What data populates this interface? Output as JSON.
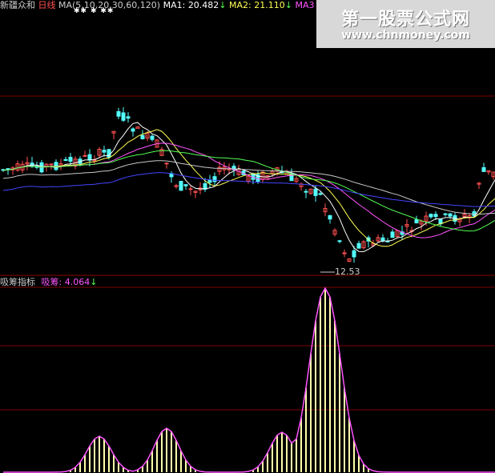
{
  "header": {
    "stock_name": "新疆众和",
    "period": "日线",
    "ma_label": "MA(5,10,20,30,60,120)",
    "ma1_label": "MA1:",
    "ma1_value": "20.482",
    "ma1_arrow": "↓",
    "ma2_label": "MA2:",
    "ma2_value": "21.110",
    "ma2_arrow": "↓",
    "ma3_label": "MA3",
    "marks": "✱✱  ✱    ✱✱"
  },
  "watermark": {
    "title": "第一股票公式网",
    "url": "www.chnmoney.com"
  },
  "low_price_label": "12.53",
  "indicator": {
    "panel_name": "吸筹指标",
    "line_label": "吸筹:",
    "line_value": "4.064",
    "line_arrow": "↓"
  },
  "colors": {
    "background": "#000000",
    "up_candle": "#ff5050",
    "down_candle": "#54ffff",
    "ma1": "#ffffff",
    "ma2": "#ffff54",
    "ma3": "#ff54ff",
    "ma4": "#54ff54",
    "ma5": "#c8c8c8",
    "ma6": "#4444ff",
    "grid": "#800000",
    "indicator_line": "#ff54ff",
    "indicator_bar": "#ffffaa"
  }
}
